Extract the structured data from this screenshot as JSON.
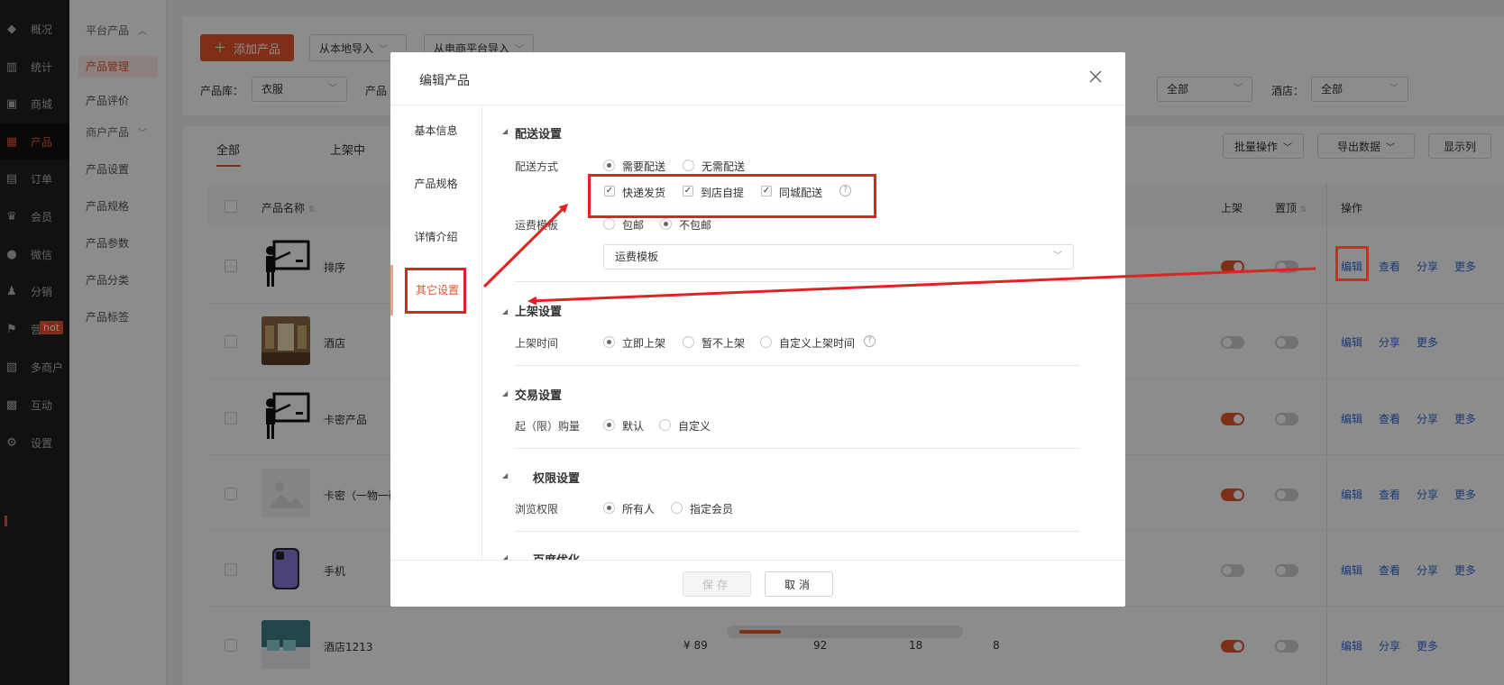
{
  "nav": {
    "items": [
      {
        "label": "概况",
        "icon": "layers-icon"
      },
      {
        "label": "统计",
        "icon": "chart-icon"
      },
      {
        "label": "商城",
        "icon": "store-icon"
      },
      {
        "label": "产品",
        "icon": "grid-icon"
      },
      {
        "label": "订单",
        "icon": "order-icon"
      },
      {
        "label": "会员",
        "icon": "crown-icon"
      },
      {
        "label": "微信",
        "icon": "wechat-icon"
      },
      {
        "label": "分销",
        "icon": "user-share-icon"
      },
      {
        "label": "营销",
        "icon": "flag-icon"
      },
      {
        "label": "多商户",
        "icon": "shop-icon"
      },
      {
        "label": "互动",
        "icon": "interact-icon"
      },
      {
        "label": "设置",
        "icon": "gear-icon"
      }
    ],
    "hot_badge": "hot"
  },
  "submenu": {
    "group1": "平台产品",
    "items1": [
      "产品管理",
      "产品评价"
    ],
    "group2": "商户产品",
    "items2": [
      "产品设置",
      "产品规格",
      "产品参数",
      "产品分类",
      "产品标签"
    ]
  },
  "toolbar": {
    "add_label": "添加产品",
    "import_local": "从本地导入",
    "import_ecom": "从电商平台导入"
  },
  "filters": {
    "lib_label": "产品库：",
    "lib_value": "衣服",
    "prod_label": "产品",
    "all_value": "全部",
    "hotel_label": "酒店：",
    "hotel_value": "全部"
  },
  "tabs": [
    "全部",
    "上架中"
  ],
  "actions": {
    "batch": "批量操作",
    "export": "导出数据",
    "columns": "显示列"
  },
  "table": {
    "headers": {
      "name": "产品名称",
      "on_shelf": "上架",
      "top": "置顶",
      "ops": "操作"
    },
    "rows": [
      {
        "name": "排序",
        "ops": [
          "编辑",
          "查看",
          "分享",
          "更多"
        ],
        "shelf": true
      },
      {
        "name": "酒店",
        "ops": [
          "编辑",
          "分享",
          "更多"
        ],
        "shelf": false
      },
      {
        "name": "卡密产品",
        "ops": [
          "编辑",
          "查看",
          "分享",
          "更多"
        ],
        "shelf": true
      },
      {
        "name": "卡密（一物一码",
        "ops": [
          "编辑",
          "查看",
          "分享",
          "更多"
        ],
        "shelf": true
      },
      {
        "name": "手机",
        "ops": [
          "编辑",
          "查看",
          "分享",
          "更多"
        ],
        "shelf": false
      },
      {
        "name": "酒店1213",
        "price": "¥ 89",
        "c1": "92",
        "c2": "18",
        "c3": "8",
        "ops": [
          "编辑",
          "分享",
          "更多"
        ],
        "shelf": true
      }
    ]
  },
  "modal": {
    "title": "编辑产品",
    "side_tabs": [
      "基本信息",
      "产品规格",
      "详情介绍",
      "其它设置"
    ],
    "delivery": {
      "section": "配送设置",
      "method_label": "配送方式",
      "opt_need": "需要配送",
      "opt_none": "无需配送",
      "cb_express": "快递发货",
      "cb_pickup": "到店自提",
      "cb_city": "同城配送",
      "fee_label": "运费模板",
      "opt_free": "包邮",
      "opt_notfree": "不包邮",
      "template_value": "运费模板"
    },
    "shelf": {
      "section": "上架设置",
      "time_label": "上架时间",
      "opt_now": "立即上架",
      "opt_later": "暂不上架",
      "opt_custom": "自定义上架时间"
    },
    "trade": {
      "section": "交易设置",
      "qty_label": "起（限）购量",
      "opt_default": "默认",
      "opt_custom": "自定义"
    },
    "perm": {
      "section": "权限设置",
      "view_label": "浏览权限",
      "opt_all": "所有人",
      "opt_member": "指定会员"
    },
    "seo": {
      "section": "百度优化"
    },
    "save": "保存",
    "cancel": "取消"
  },
  "colors": {
    "accent": "#e8542b",
    "annotation": "#e02222",
    "link": "#2d6bd7"
  }
}
